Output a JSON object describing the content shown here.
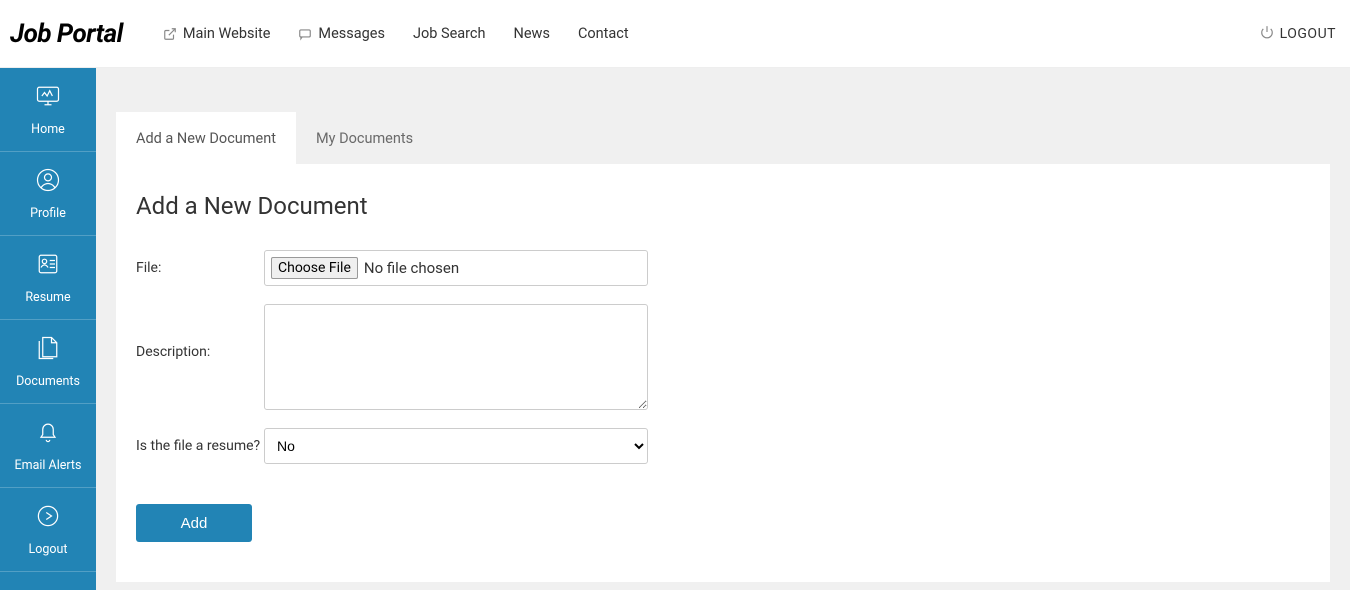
{
  "header": {
    "logo": "Job Portal",
    "nav": [
      {
        "label": "Main Website",
        "icon": "external-link-icon"
      },
      {
        "label": "Messages",
        "icon": "chat-icon"
      },
      {
        "label": "Job Search",
        "icon": ""
      },
      {
        "label": "News",
        "icon": ""
      },
      {
        "label": "Contact",
        "icon": ""
      }
    ],
    "logout": "LOGOUT"
  },
  "sidebar": {
    "items": [
      {
        "label": "Home",
        "icon": "home-icon"
      },
      {
        "label": "Profile",
        "icon": "profile-icon"
      },
      {
        "label": "Resume",
        "icon": "resume-icon"
      },
      {
        "label": "Documents",
        "icon": "documents-icon"
      },
      {
        "label": "Email Alerts",
        "icon": "bell-icon"
      },
      {
        "label": "Logout",
        "icon": "logout-icon"
      }
    ]
  },
  "tabs": [
    {
      "label": "Add a New Document",
      "active": true
    },
    {
      "label": "My Documents",
      "active": false
    }
  ],
  "page": {
    "title": "Add a New Document",
    "form": {
      "file_label": "File:",
      "file_button": "Choose File",
      "file_status": "No file chosen",
      "description_label": "Description:",
      "description_value": "",
      "resume_label": "Is the file a resume?",
      "resume_value": "No",
      "submit_label": "Add"
    }
  },
  "colors": {
    "accent": "#2284b5"
  }
}
